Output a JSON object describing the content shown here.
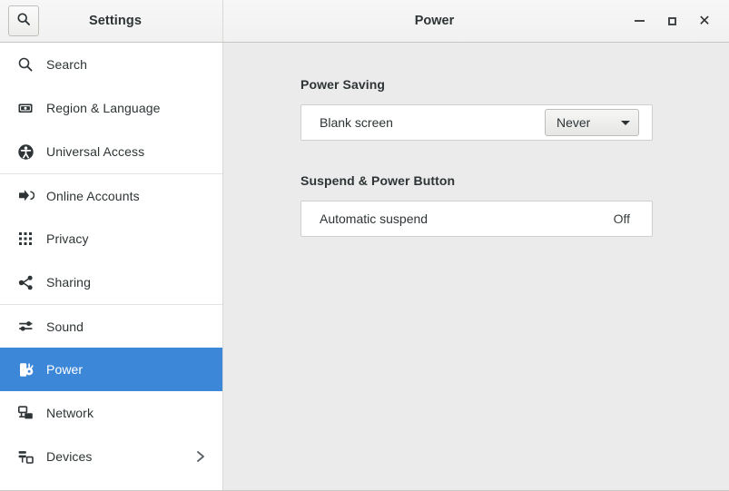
{
  "window": {
    "sidebar_title": "Settings",
    "page_title": "Power",
    "controls": {
      "minimize": "minimize-button",
      "maximize": "maximize-button",
      "close": "close-button"
    }
  },
  "search": {
    "icon": "search-icon",
    "tooltip": "Search"
  },
  "sidebar": {
    "items": [
      {
        "label": "Search",
        "icon": "search-icon",
        "selected": false,
        "separator_above": false,
        "chevron": false
      },
      {
        "label": "Region & Language",
        "icon": "region-language-icon",
        "selected": false,
        "separator_above": false,
        "chevron": false
      },
      {
        "label": "Universal Access",
        "icon": "accessibility-icon",
        "selected": false,
        "separator_above": false,
        "chevron": false
      },
      {
        "label": "Online Accounts",
        "icon": "online-accounts-icon",
        "selected": false,
        "separator_above": true,
        "chevron": false
      },
      {
        "label": "Privacy",
        "icon": "privacy-icon",
        "selected": false,
        "separator_above": false,
        "chevron": false
      },
      {
        "label": "Sharing",
        "icon": "sharing-icon",
        "selected": false,
        "separator_above": false,
        "chevron": false
      },
      {
        "label": "Sound",
        "icon": "sound-icon",
        "selected": false,
        "separator_above": true,
        "chevron": false
      },
      {
        "label": "Power",
        "icon": "power-icon",
        "selected": true,
        "separator_above": false,
        "chevron": false
      },
      {
        "label": "Network",
        "icon": "network-icon",
        "selected": false,
        "separator_above": false,
        "chevron": false
      },
      {
        "label": "Devices",
        "icon": "devices-icon",
        "selected": false,
        "separator_above": false,
        "chevron": true
      }
    ]
  },
  "main": {
    "sections": [
      {
        "title": "Power Saving",
        "rows": [
          {
            "label": "Blank screen",
            "control": "combo",
            "value": "Never"
          }
        ]
      },
      {
        "title": "Suspend & Power Button",
        "rows": [
          {
            "label": "Automatic suspend",
            "control": "text",
            "value": "Off"
          }
        ]
      }
    ]
  },
  "colors": {
    "selection": "#3d87d8",
    "content_background": "#ebebeb",
    "sidebar_background": "#ffffff",
    "header_background": "#f3f3f2",
    "text": "#2e3436"
  }
}
